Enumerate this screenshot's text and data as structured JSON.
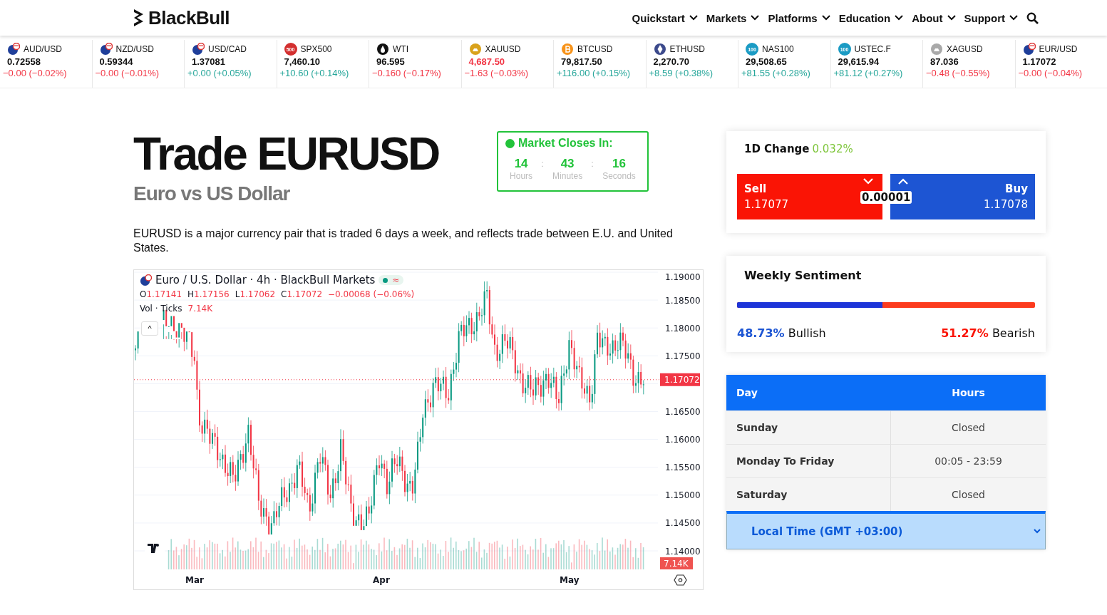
{
  "brand": "BlackBull",
  "nav": [
    "Quickstart",
    "Markets",
    "Platforms",
    "Education",
    "About",
    "Support"
  ],
  "tickers": [
    {
      "symbol": "AUD/USD",
      "price": "0.72558",
      "change": "−0.00 (−0.02%)",
      "rising": false,
      "price_colored": false,
      "kind": "flag"
    },
    {
      "symbol": "NZD/USD",
      "price": "0.59344",
      "change": "−0.00 (−0.01%)",
      "rising": false,
      "price_colored": false,
      "kind": "flag"
    },
    {
      "symbol": "USD/CAD",
      "price": "1.37081",
      "change": "+0.00 (+0.05%)",
      "rising": true,
      "price_colored": false,
      "kind": "flag"
    },
    {
      "symbol": "SPX500",
      "price": "7,460.10",
      "change": "+10.60 (+0.14%)",
      "rising": true,
      "price_colored": false,
      "kind": "badge",
      "badge": "500",
      "color": "#d32f2f"
    },
    {
      "symbol": "WTI",
      "price": "96.595",
      "change": "−0.160 (−0.17%)",
      "rising": false,
      "price_colored": false,
      "kind": "drop"
    },
    {
      "symbol": "XAUUSD",
      "price": "4,687.50",
      "change": "−1.63 (−0.03%)",
      "rising": false,
      "price_colored": true,
      "kind": "bars",
      "color": "#d9a21b"
    },
    {
      "symbol": "BTCUSD",
      "price": "79,817.50",
      "change": "+116.00 (+0.15%)",
      "rising": true,
      "price_colored": false,
      "kind": "coin",
      "color": "#f7931a"
    },
    {
      "symbol": "ETHUSD",
      "price": "2,270.70",
      "change": "+8.59 (+0.38%)",
      "rising": true,
      "price_colored": false,
      "kind": "diamond",
      "color": "#3c4a8c"
    },
    {
      "symbol": "NAS100",
      "price": "29,508.65",
      "change": "+81.55 (+0.28%)",
      "rising": true,
      "price_colored": false,
      "kind": "badge",
      "badge": "100",
      "color": "#1a9bc4"
    },
    {
      "symbol": "USTEC.F",
      "price": "29,615.94",
      "change": "+81.12 (+0.27%)",
      "rising": true,
      "price_colored": false,
      "kind": "badge",
      "badge": "100",
      "color": "#1a9bc4"
    },
    {
      "symbol": "XAGUSD",
      "price": "87.036",
      "change": "−0.48 (−0.55%)",
      "rising": false,
      "price_colored": false,
      "kind": "bars",
      "color": "#a9a9a9"
    },
    {
      "symbol": "EUR/USD",
      "price": "1.17072",
      "change": "−0.00 (−0.04%)",
      "rising": false,
      "price_colored": false,
      "kind": "flag"
    }
  ],
  "title": "Trade EURUSD",
  "subtitle": "Euro vs US Dollar",
  "description": "EURUSD is a major currency pair that is traded 6 days a week, and reflects trade between E.U. and United States.",
  "market_clock": {
    "label": "Market Closes In:",
    "separator": ":",
    "units": [
      {
        "value": "14",
        "unit": "Hours"
      },
      {
        "value": "43",
        "unit": "Minutes"
      },
      {
        "value": "16",
        "unit": "Seconds"
      }
    ]
  },
  "chart": {
    "title": "Euro / U.S. Dollar · 4h · BlackBull Markets",
    "status_glyph": "≈",
    "ohlc": [
      {
        "label": "O",
        "value": "1.17141"
      },
      {
        "label": "H",
        "value": "1.17156"
      },
      {
        "label": "L",
        "value": "1.17062"
      },
      {
        "label": "C",
        "value": "1.17072"
      }
    ],
    "change": "−0.00068 (−0.06%)",
    "volume_label": "Vol · Ticks",
    "volume_value": "7.14K",
    "yticks": [
      "1.19000",
      "1.18500",
      "1.18000",
      "1.17500",
      "1.16500",
      "1.16000",
      "1.15500",
      "1.15000",
      "1.14500",
      "1.14000"
    ],
    "price_tag": "1.17072",
    "volume_tag": "7.14K",
    "xlabels": [
      "Mar",
      "Apr",
      "May"
    ],
    "collapse_glyph": "^"
  },
  "quote": {
    "change_label": "1D Change",
    "change_value": "0.032%",
    "sell_label": "Sell",
    "sell_price": "1.17077",
    "spread": "0.00001",
    "buy_label": "Buy",
    "buy_price": "1.17078"
  },
  "sentiment": {
    "title": "Weekly Sentiment",
    "level": 0.4873,
    "bullish_pct": "48.73%",
    "bullish_label": "Bullish",
    "bearish_pct": "51.27%",
    "bearish_label": "Bearish"
  },
  "schedule": {
    "columns": [
      "Day",
      "Hours"
    ],
    "rows": [
      [
        "Sunday",
        "Closed"
      ],
      [
        "Monday To Friday",
        "00:05 - 23:59"
      ],
      [
        "Saturday",
        "Closed"
      ]
    ],
    "timezone": "Local Time (GMT +03:00)"
  }
}
